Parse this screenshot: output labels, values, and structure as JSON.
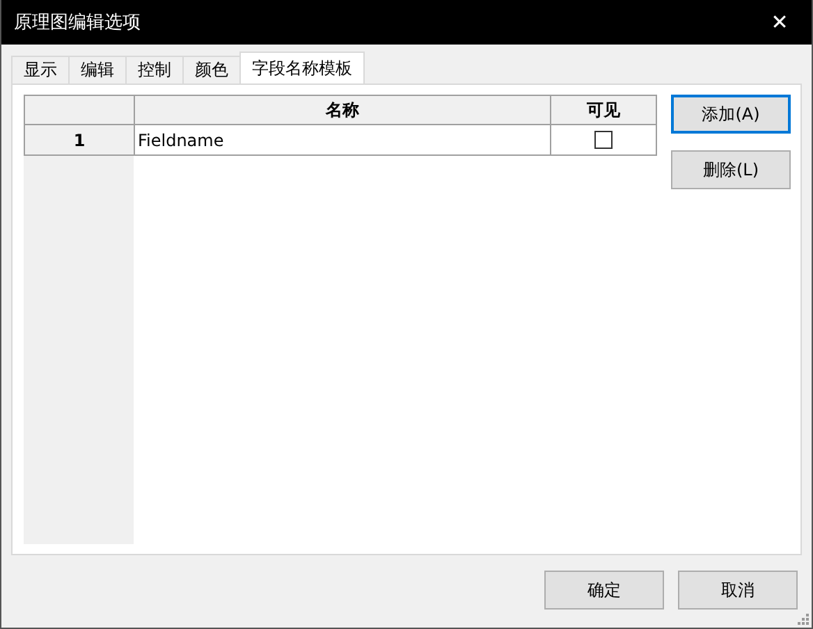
{
  "window": {
    "title": "原理图编辑选项",
    "close": "✕"
  },
  "tabs": [
    {
      "label": "显示",
      "selected": false
    },
    {
      "label": "编辑",
      "selected": false
    },
    {
      "label": "控制",
      "selected": false
    },
    {
      "label": "颜色",
      "selected": false
    },
    {
      "label": "字段名称模板",
      "selected": true
    }
  ],
  "table": {
    "columns": [
      "名称",
      "可见"
    ],
    "rows": [
      {
        "index": "1",
        "name": "Fieldname",
        "visible": false
      }
    ]
  },
  "side_buttons": [
    {
      "label": "添加(A)",
      "default": true
    },
    {
      "label": "删除(L)",
      "default": false
    }
  ],
  "buttons": [
    "确定",
    "取消"
  ]
}
